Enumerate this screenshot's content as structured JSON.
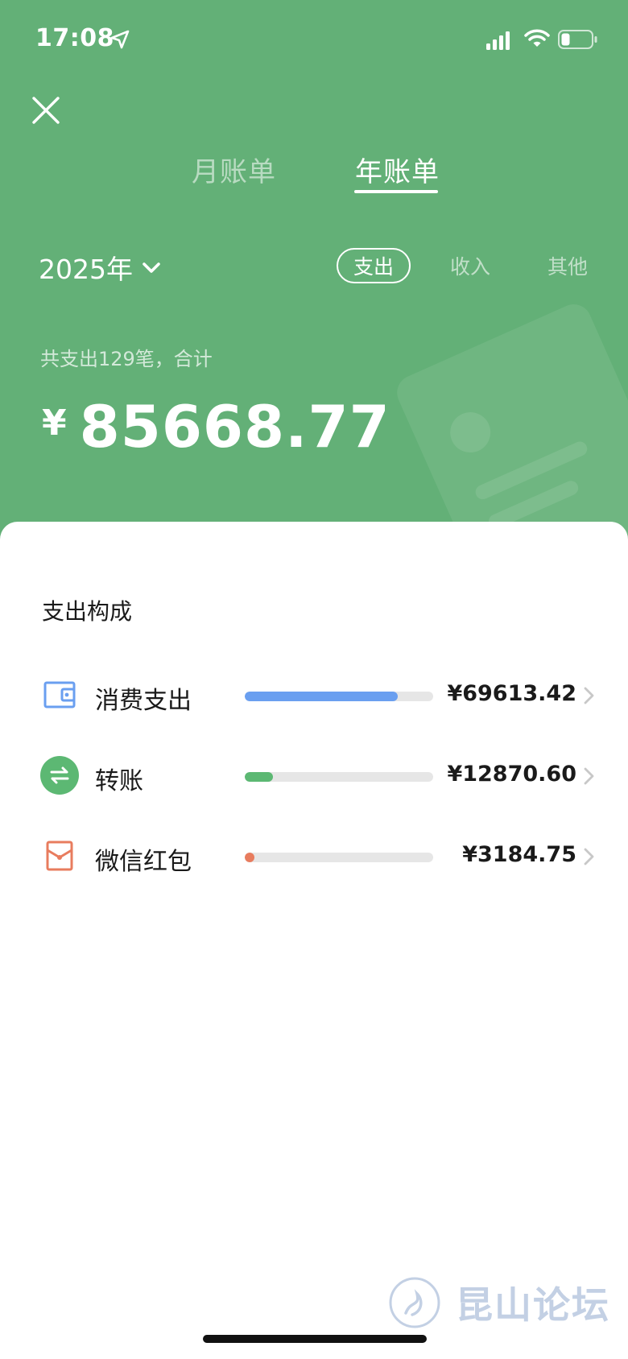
{
  "status_bar": {
    "time": "17:08",
    "icons": [
      "location-arrow-icon",
      "cellular-signal-icon",
      "wifi-icon",
      "battery-icon"
    ]
  },
  "nav": {
    "close_icon": "close-icon",
    "tabs": [
      {
        "label": "月账单",
        "active": false
      },
      {
        "label": "年账单",
        "active": true
      }
    ]
  },
  "filter": {
    "year": "2025年",
    "types": [
      {
        "label": "支出",
        "active": true
      },
      {
        "label": "收入",
        "active": false
      },
      {
        "label": "其他",
        "active": false
      }
    ]
  },
  "summary": {
    "text": "共支出129笔，合计",
    "currency": "¥",
    "total": "85668.77"
  },
  "composition": {
    "title": "支出构成",
    "items": [
      {
        "label": "消费支出",
        "amount": "¥69613.42",
        "share": 0.81,
        "color": "#6a9ff0",
        "icon": "wallet-icon"
      },
      {
        "label": "转账",
        "amount": "¥12870.60",
        "share": 0.15,
        "color": "#5cb873",
        "icon": "transfer-icon"
      },
      {
        "label": "微信红包",
        "amount": "¥3184.75",
        "share": 0.04,
        "color": "#e87c5e",
        "icon": "red-packet-icon"
      }
    ]
  },
  "watermark": {
    "text": "昆山论坛"
  },
  "colors": {
    "header_bg": "#63b077",
    "card_bg": "#ffffff"
  }
}
